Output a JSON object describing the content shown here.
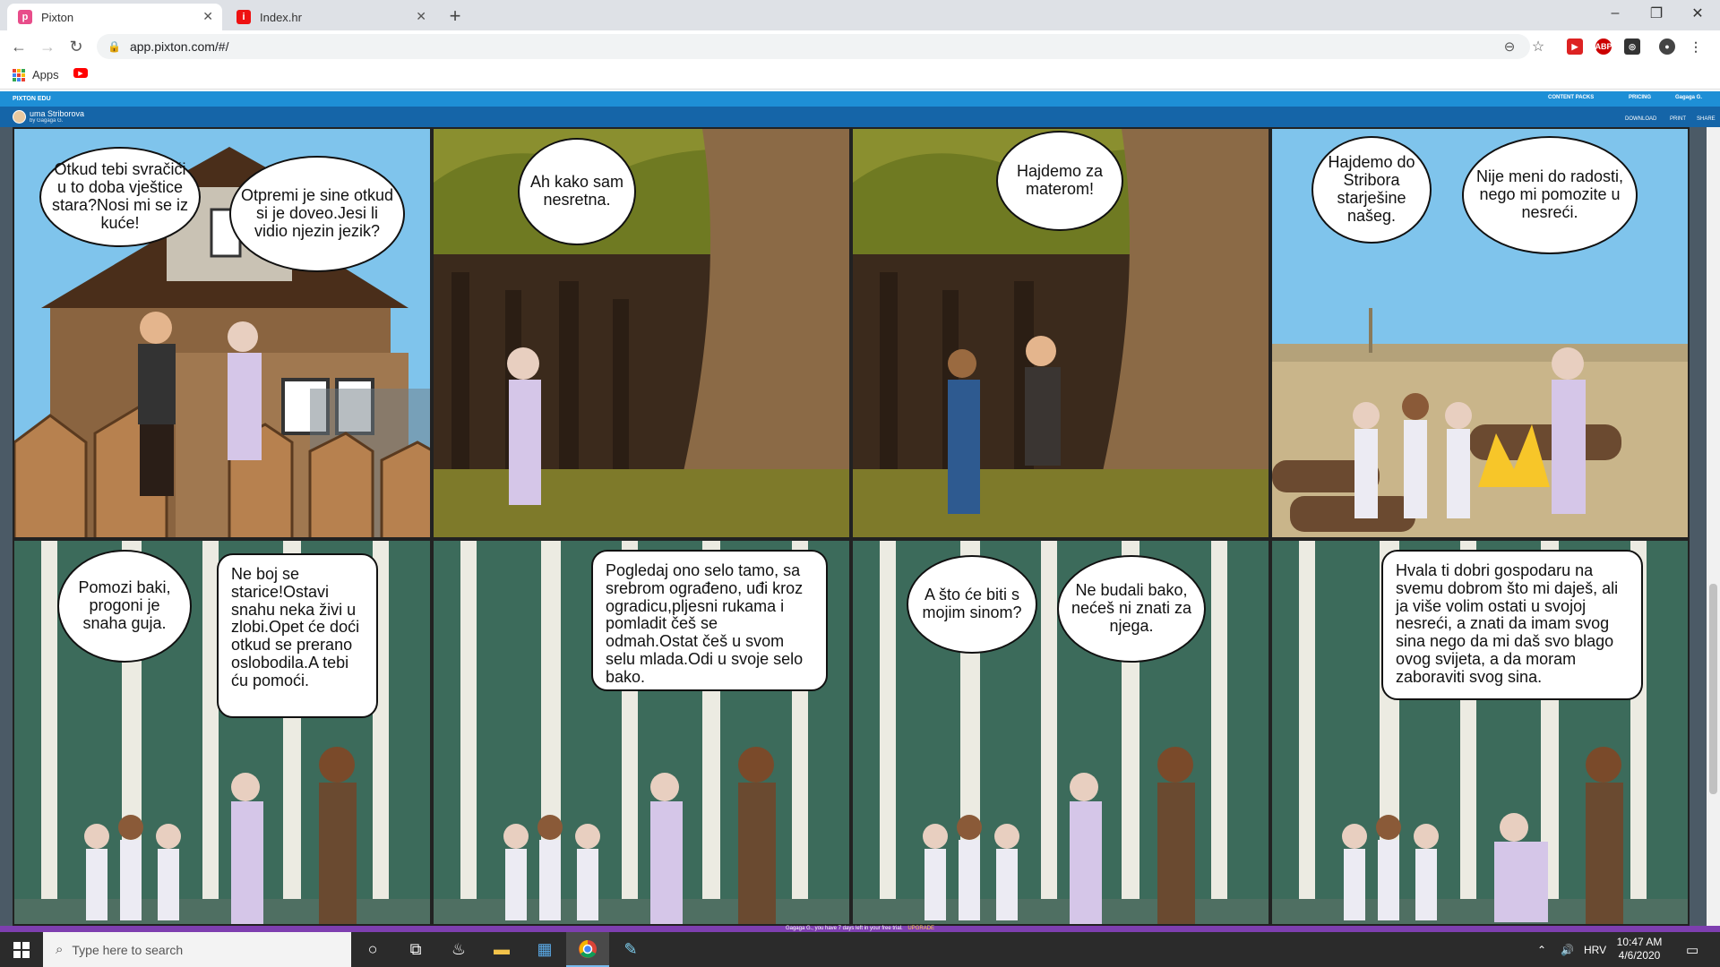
{
  "browser": {
    "tabs": [
      {
        "title": "Pixton",
        "favicon": "pixton-icon"
      },
      {
        "title": "Index.hr",
        "favicon": "index-hr-icon"
      }
    ],
    "url": "app.pixton.com/#/",
    "bookmarks": [
      {
        "label": "Apps"
      }
    ]
  },
  "pixton": {
    "brand": "PIXTON EDU",
    "top_links": [
      "CONTENT PACKS",
      "PRICING",
      "Gagaga G."
    ],
    "comic_title": "uma Striborova",
    "comic_author": "by Gagaga G.",
    "actions": [
      "DOWNLOAD",
      "PRINT",
      "SHARE"
    ]
  },
  "panels": [
    {
      "bubbles": [
        "Otkud tebi svračići u to doba vještice stara?Nosi mi se iz kuće!",
        "Otpremi je sine otkud si je doveo.Jesi li vidio njezin jezik?"
      ]
    },
    {
      "bubbles": [
        "Ah kako sam nesretna."
      ]
    },
    {
      "bubbles": [
        "Hajdemo za materom!"
      ]
    },
    {
      "bubbles": [
        "Hajdemo do Stribora starješine našeg.",
        "Nije meni do radosti, nego mi pomozite u nesreći."
      ]
    },
    {
      "bubbles": [
        "Pomozi baki, progoni je snaha guja.",
        "Ne boj se starice!Ostavi snahu neka živi u zlobi.Opet će doći otkud se prerano oslobodila.A tebi ću pomoći."
      ]
    },
    {
      "bubbles": [
        "Pogledaj ono selo tamo, sa srebrom ograđeno, uđi kroz ogradicu,pljesni rukama i pomladit češ se odmah.Ostat češ u svom selu mlada.Odi u svoje selo bako."
      ]
    },
    {
      "bubbles": [
        "A što će biti s mojim sinom?",
        "Ne budali bako, nećeš ni znati za njega."
      ]
    },
    {
      "bubbles": [
        "Hvala ti dobri gospodaru na svemu dobrom što mi daješ, ali ja više volim ostati u svojoj nesreći, a znati da imam svog sina nego da mi daš svo blago ovog svijeta, a da moram zaboraviti svog sina."
      ]
    }
  ],
  "trial_notice": "Gagaga G., you have 7 days left in your free trial.",
  "trial_link": "UPGRADE",
  "taskbar": {
    "search_placeholder": "Type here to search",
    "language": "HRV",
    "time": "10:47 AM",
    "date": "4/6/2020"
  },
  "colors": {
    "pixton_blue": "#1e8fd6",
    "pixton_dark": "#1565a8",
    "trial_purple": "#7e3fb0"
  }
}
